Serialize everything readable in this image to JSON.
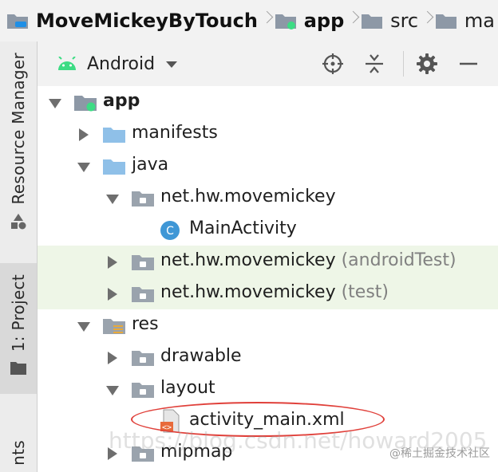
{
  "breadcrumb": [
    {
      "label": "MoveMickeyByTouch",
      "bold": true
    },
    {
      "label": "app",
      "bold": true
    },
    {
      "label": "src",
      "bold": false
    },
    {
      "label": "ma",
      "bold": false
    }
  ],
  "stripe": {
    "resource_manager": "Resource Manager",
    "project": "1: Project",
    "structure_partial": "nts"
  },
  "toolbar": {
    "view_mode": "Android"
  },
  "tree": [
    {
      "label": "app",
      "extra": "",
      "depth": 0,
      "state": "down",
      "icon": "module-icon",
      "bold": true,
      "highlight": false
    },
    {
      "label": "manifests",
      "extra": "",
      "depth": 1,
      "state": "right",
      "icon": "folder-icon",
      "bold": false,
      "highlight": false
    },
    {
      "label": "java",
      "extra": "",
      "depth": 1,
      "state": "down",
      "icon": "folder-icon",
      "bold": false,
      "highlight": false
    },
    {
      "label": "net.hw.movemickey",
      "extra": "",
      "depth": 2,
      "state": "down",
      "icon": "package-icon",
      "bold": false,
      "highlight": false
    },
    {
      "label": "MainActivity",
      "extra": "",
      "depth": 3,
      "state": "none",
      "icon": "class-icon",
      "bold": false,
      "highlight": false
    },
    {
      "label": "net.hw.movemickey",
      "extra": " (androidTest)",
      "depth": 2,
      "state": "right",
      "icon": "package-icon",
      "bold": false,
      "highlight": true
    },
    {
      "label": "net.hw.movemickey",
      "extra": " (test)",
      "depth": 2,
      "state": "right",
      "icon": "package-icon",
      "bold": false,
      "highlight": true
    },
    {
      "label": "res",
      "extra": "",
      "depth": 1,
      "state": "down",
      "icon": "res-folder-icon",
      "bold": false,
      "highlight": false
    },
    {
      "label": "drawable",
      "extra": "",
      "depth": 2,
      "state": "right",
      "icon": "package-icon",
      "bold": false,
      "highlight": false
    },
    {
      "label": "layout",
      "extra": "",
      "depth": 2,
      "state": "down",
      "icon": "package-icon",
      "bold": false,
      "highlight": false
    },
    {
      "label": "activity_main.xml",
      "extra": "",
      "depth": 3,
      "state": "none",
      "icon": "xml-file-icon",
      "bold": false,
      "highlight": false
    },
    {
      "label": "mipmap",
      "extra": "",
      "depth": 2,
      "state": "right",
      "icon": "package-icon",
      "bold": false,
      "highlight": false
    }
  ],
  "watermark": "https://blog.csdn.net/howard2005",
  "watermark_brand": "@稀土掘金技术社区",
  "colors": {
    "highlight_row": "#eef6e7",
    "annotation_circle": "#e0403a",
    "android_green": "#3ddc84",
    "class_icon_blue": "#3f97d6"
  }
}
